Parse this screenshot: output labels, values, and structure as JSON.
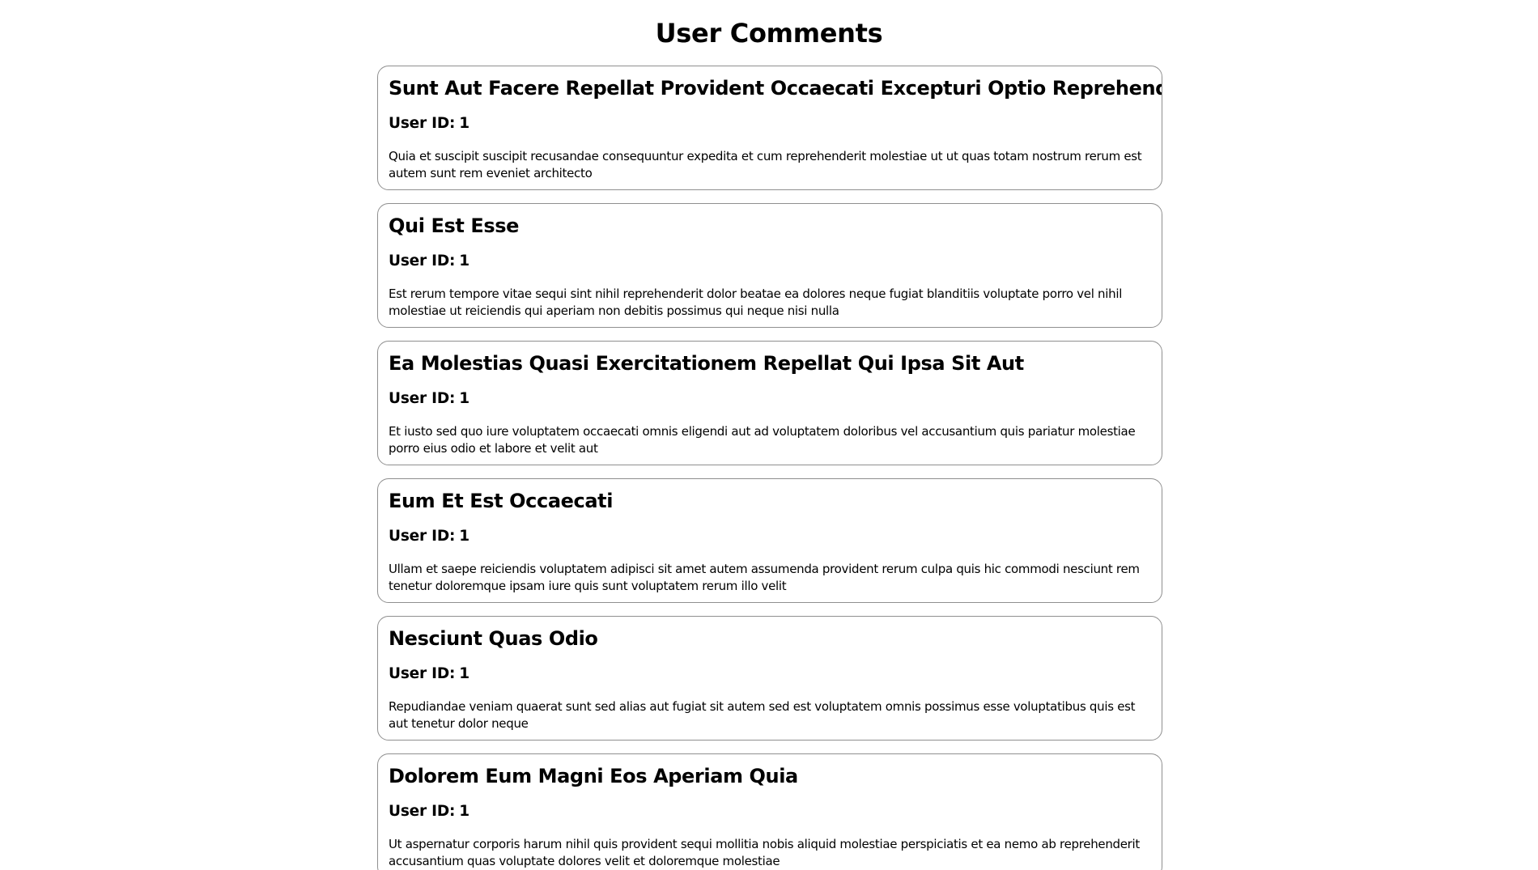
{
  "page": {
    "title": "User Comments"
  },
  "labels": {
    "user_id": "User ID:"
  },
  "comments": [
    {
      "title": "Sunt Aut Facere Repellat Provident Occaecati Excepturi Optio Reprehenderit",
      "user_id": "1",
      "body": "Quia et suscipit suscipit recusandae consequuntur expedita et cum reprehenderit molestiae ut ut quas totam nostrum rerum est autem sunt rem eveniet architecto"
    },
    {
      "title": "Qui Est Esse",
      "user_id": "1",
      "body": "Est rerum tempore vitae sequi sint nihil reprehenderit dolor beatae ea dolores neque fugiat blanditiis voluptate porro vel nihil molestiae ut reiciendis qui aperiam non debitis possimus qui neque nisi nulla"
    },
    {
      "title": "Ea Molestias Quasi Exercitationem Repellat Qui Ipsa Sit Aut",
      "user_id": "1",
      "body": "Et iusto sed quo iure voluptatem occaecati omnis eligendi aut ad voluptatem doloribus vel accusantium quis pariatur molestiae porro eius odio et labore et velit aut"
    },
    {
      "title": "Eum Et Est Occaecati",
      "user_id": "1",
      "body": "Ullam et saepe reiciendis voluptatem adipisci sit amet autem assumenda provident rerum culpa quis hic commodi nesciunt rem tenetur doloremque ipsam iure quis sunt voluptatem rerum illo velit"
    },
    {
      "title": "Nesciunt Quas Odio",
      "user_id": "1",
      "body": "Repudiandae veniam quaerat sunt sed alias aut fugiat sit autem sed est voluptatem omnis possimus esse voluptatibus quis est aut tenetur dolor neque"
    },
    {
      "title": "Dolorem Eum Magni Eos Aperiam Quia",
      "user_id": "1",
      "body": "Ut aspernatur corporis harum nihil quis provident sequi mollitia nobis aliquid molestiae perspiciatis et ea nemo ab reprehenderit accusantium quas voluptate dolores velit et doloremque molestiae"
    }
  ]
}
